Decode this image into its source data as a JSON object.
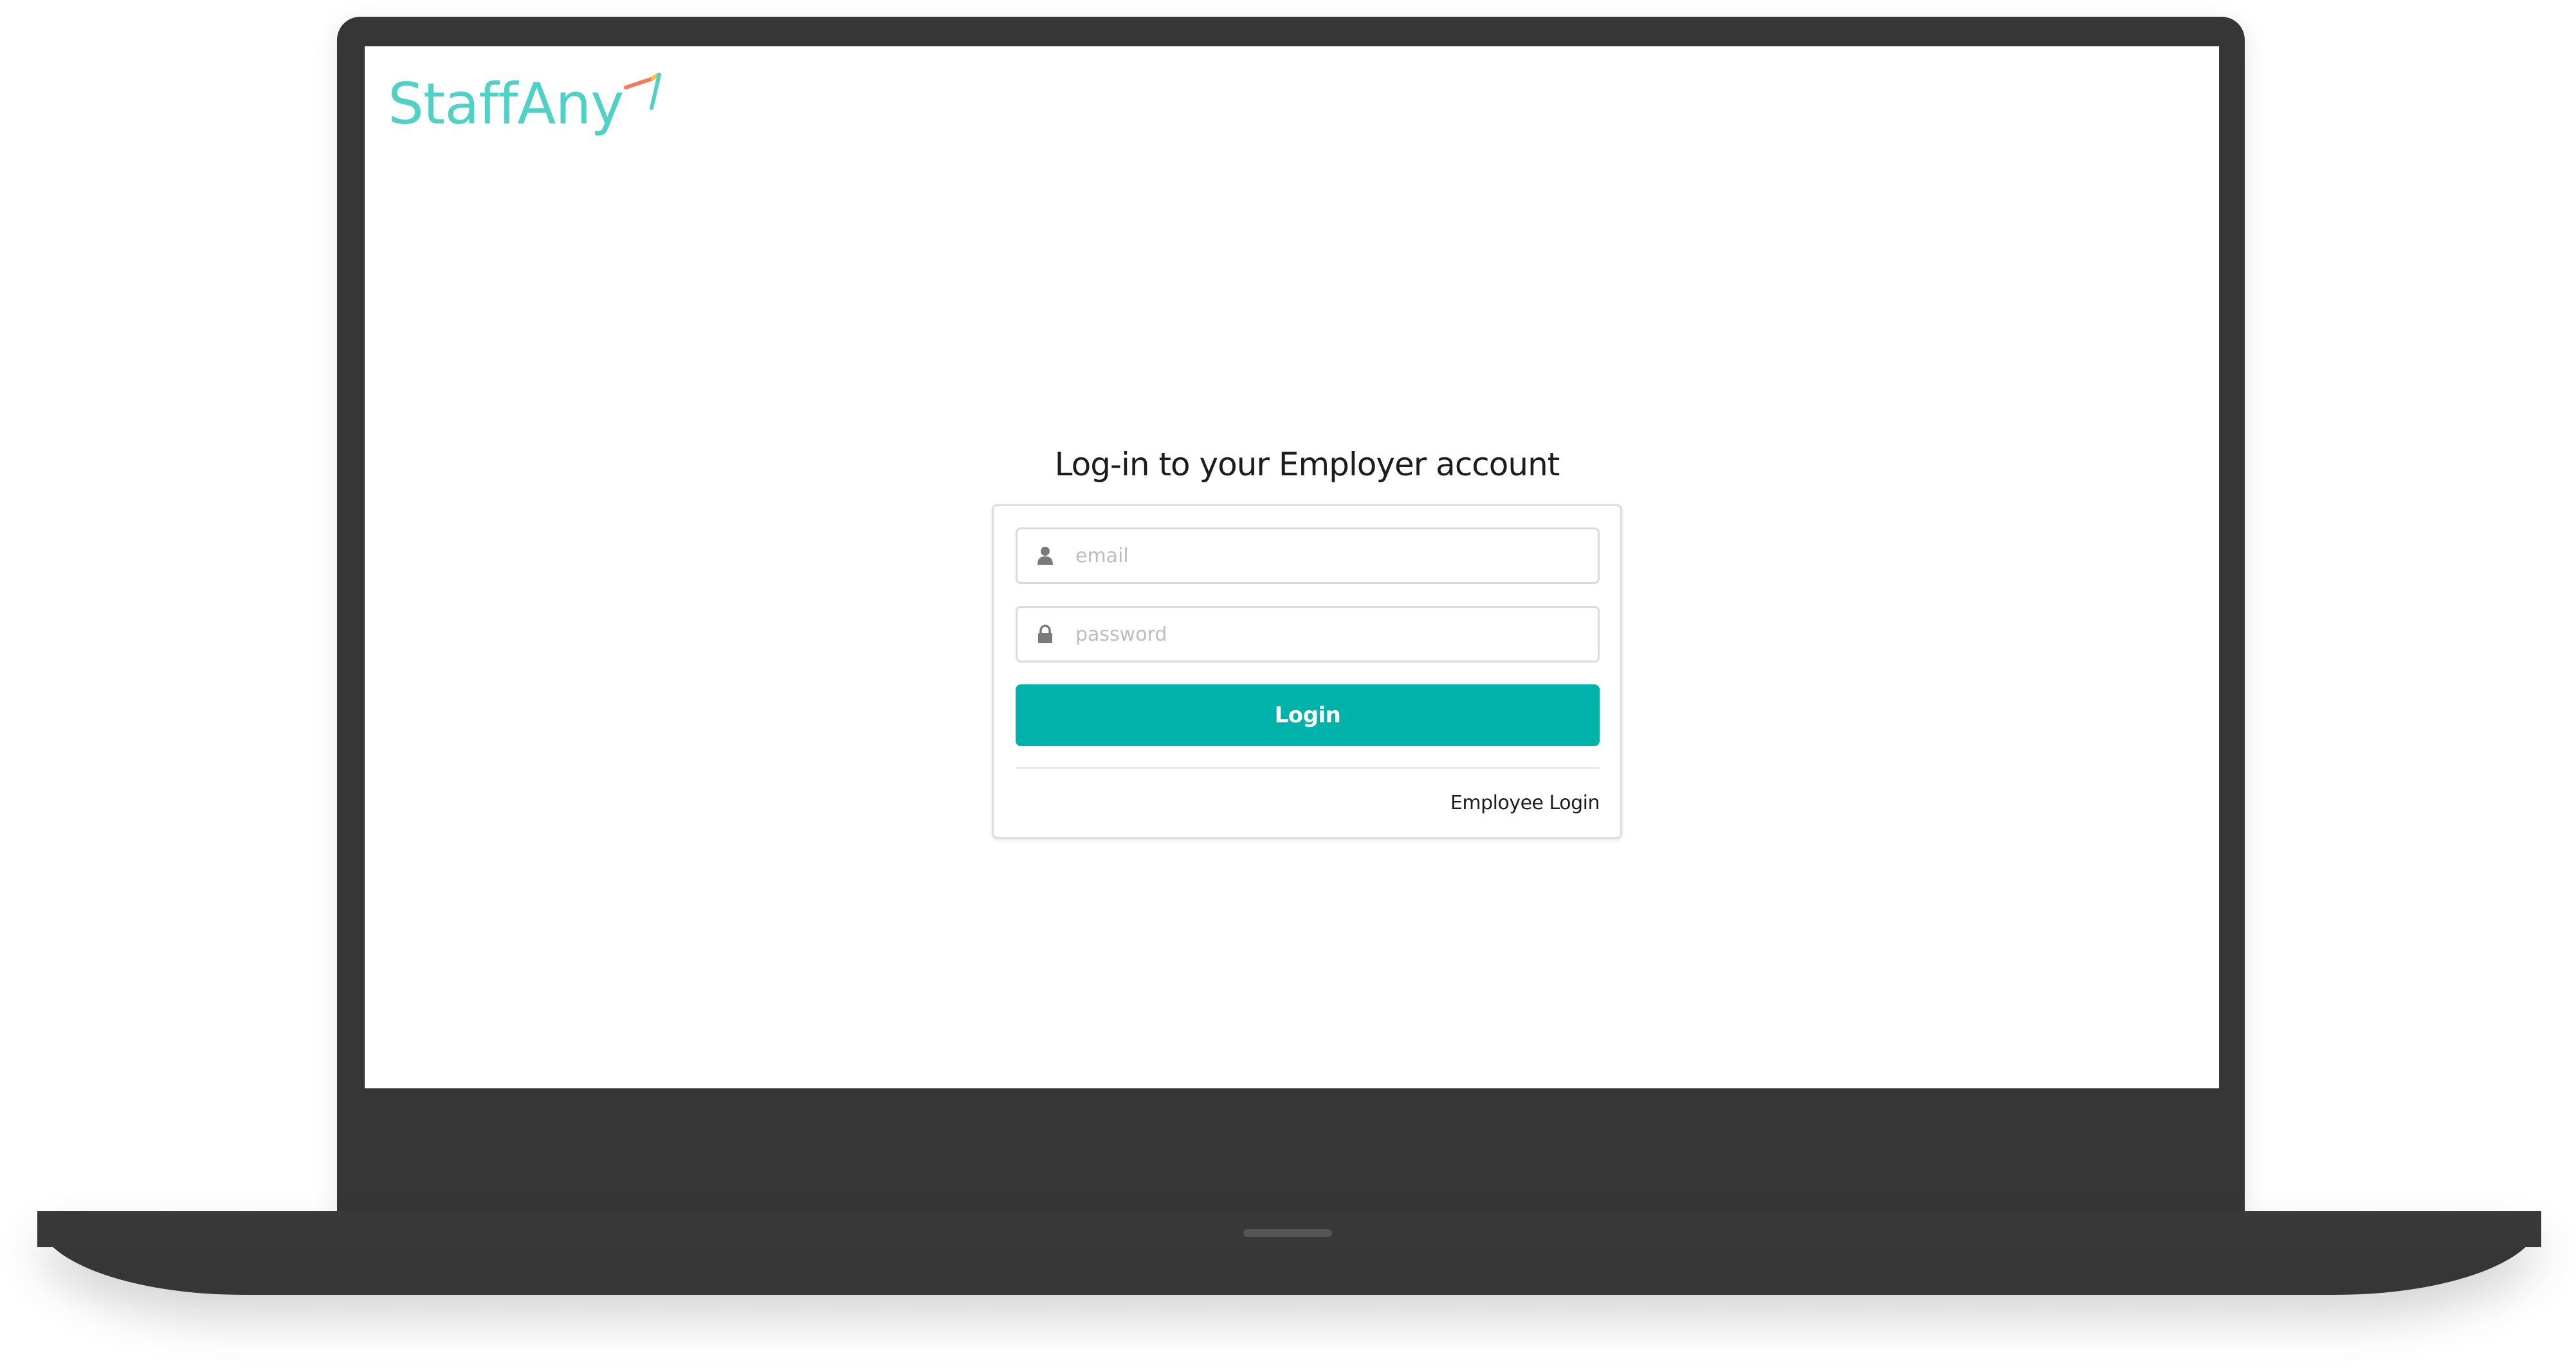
{
  "app": {
    "logo_text": "StaffAny",
    "brand_color": "#4fd1c5",
    "accent_color": "#00b2a9"
  },
  "login": {
    "title": "Log-in to your Employer account",
    "email": {
      "placeholder": "email",
      "value": "",
      "icon": "user-icon"
    },
    "password": {
      "placeholder": "password",
      "value": "",
      "icon": "lock-icon"
    },
    "submit_label": "Login",
    "employee_link_label": "Employee Login"
  }
}
